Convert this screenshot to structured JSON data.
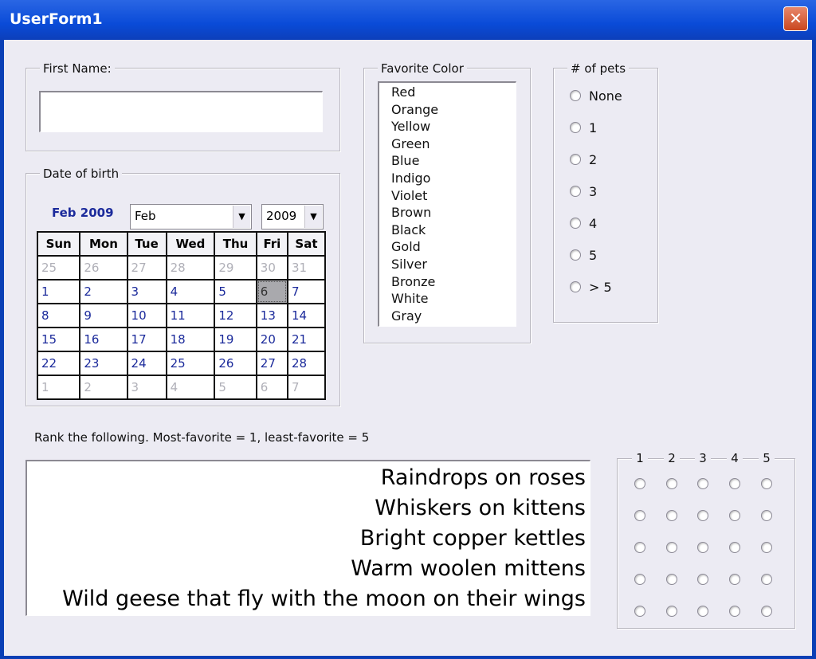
{
  "window": {
    "title": "UserForm1"
  },
  "first_name": {
    "label": "First Name:",
    "value": ""
  },
  "date_of_birth": {
    "label": "Date of birth",
    "calendar_title": "Feb 2009",
    "month_value": "Feb",
    "year_value": "2009",
    "weekdays": [
      "Sun",
      "Mon",
      "Tue",
      "Wed",
      "Thu",
      "Fri",
      "Sat"
    ],
    "weeks": [
      [
        "25",
        "26",
        "27",
        "28",
        "29",
        "30",
        "31"
      ],
      [
        "1",
        "2",
        "3",
        "4",
        "5",
        "6",
        "7"
      ],
      [
        "8",
        "9",
        "10",
        "11",
        "12",
        "13",
        "14"
      ],
      [
        "15",
        "16",
        "17",
        "18",
        "19",
        "20",
        "21"
      ],
      [
        "22",
        "23",
        "24",
        "25",
        "26",
        "27",
        "28"
      ],
      [
        "1",
        "2",
        "3",
        "4",
        "5",
        "6",
        "7"
      ]
    ],
    "selected_day": "6"
  },
  "favorite_color": {
    "label": "Favorite Color",
    "options": [
      "Red",
      "Orange",
      "Yellow",
      "Green",
      "Blue",
      "Indigo",
      "Violet",
      "Brown",
      "Black",
      "Gold",
      "Silver",
      "Bronze",
      "White",
      "Gray"
    ]
  },
  "pets": {
    "label": "# of pets",
    "options": [
      "None",
      "1",
      "2",
      "3",
      "4",
      "5",
      "> 5"
    ]
  },
  "rank": {
    "instruction": "Rank the following.  Most-favorite = 1, least-favorite = 5",
    "items": [
      "Raindrops on roses",
      "Whiskers on kittens",
      "Bright copper kettles",
      "Warm woolen mittens",
      "Wild geese that fly with the moon on their wings"
    ],
    "columns": [
      "1",
      "2",
      "3",
      "4",
      "5"
    ]
  },
  "colors": {
    "titlebar": "#0a4bd8",
    "calendar_text": "#1b2a9b",
    "close_button": "#c9471f"
  }
}
